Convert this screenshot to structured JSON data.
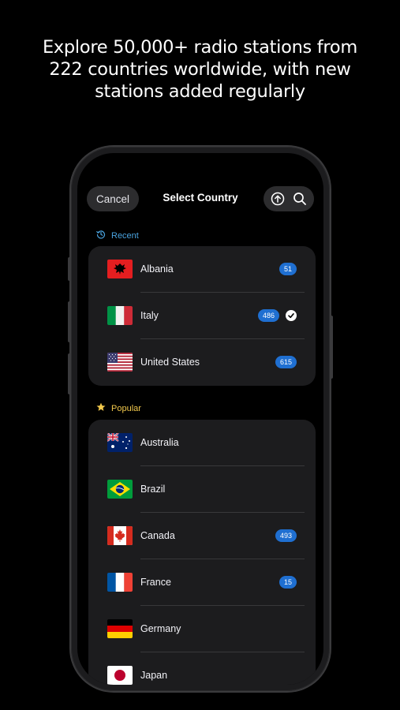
{
  "headline": {
    "line1": "Explore 50,000+ radio stations from",
    "line2": "222 countries worldwide, with new",
    "line3": "stations added regularly"
  },
  "nav": {
    "cancel_label": "Cancel",
    "title": "Select Country",
    "icons": [
      "upload-circle-icon",
      "search-icon"
    ]
  },
  "recent": {
    "label": "Recent",
    "icon": "history-clock-icon",
    "color": "#4aa3df",
    "items": [
      {
        "name": "Albania",
        "count": "51",
        "selected": false
      },
      {
        "name": "Italy",
        "count": "486",
        "selected": true
      },
      {
        "name": "United States",
        "count": "615",
        "selected": false
      }
    ]
  },
  "popular": {
    "label": "Popular",
    "icon": "star-icon",
    "color": "#f2c94c",
    "items": [
      {
        "name": "Australia",
        "count": ""
      },
      {
        "name": "Brazil",
        "count": ""
      },
      {
        "name": "Canada",
        "count": "493"
      },
      {
        "name": "France",
        "count": "15"
      },
      {
        "name": "Germany",
        "count": ""
      },
      {
        "name": "Japan",
        "count": ""
      }
    ]
  },
  "colors": {
    "badge": "#1f6fd1",
    "card": "#1c1c1e",
    "background": "#000000"
  }
}
